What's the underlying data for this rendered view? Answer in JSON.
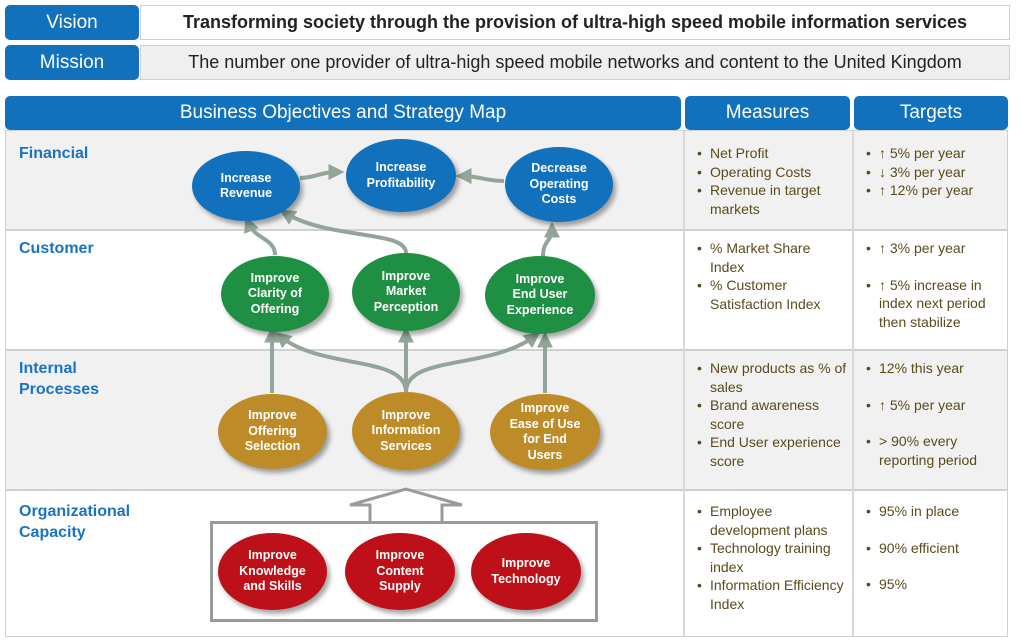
{
  "vision": {
    "label": "Vision",
    "text": "Transforming society through the provision of ultra-high speed mobile information services"
  },
  "mission": {
    "label": "Mission",
    "text": "The number one provider of ultra-high speed mobile networks and content to the United Kingdom"
  },
  "columns": {
    "map": "Business Objectives and Strategy Map",
    "measures": "Measures",
    "targets": "Targets"
  },
  "colors": {
    "header_blue": "#1171bd",
    "financial": "#1171bd",
    "customer": "#1f8f44",
    "internal": "#bd8c29",
    "capacity": "#bd1019",
    "connector": "#92a598",
    "label_blue": "#1a73c2",
    "list_text": "#5a4a1c"
  },
  "rows": [
    {
      "label": "Financial",
      "nodes": [
        "Increase\nRevenue",
        "Increase\nProfitability",
        "Decrease\nOperating\nCosts"
      ],
      "measures": [
        "Net Profit",
        "Operating Costs",
        "Revenue in target markets"
      ],
      "targets": [
        "↑ 5% per year",
        "↓ 3% per year",
        "↑ 12% per year"
      ]
    },
    {
      "label": "Customer",
      "nodes": [
        "Improve\nClarity of\nOffering",
        "Improve\nMarket\nPerception",
        "Improve\nEnd User\nExperience"
      ],
      "measures": [
        "% Market Share Index",
        "% Customer Satisfaction Index"
      ],
      "targets": [
        "↑ 3% per year",
        "↑ 5% increase in index next period then stabilize"
      ]
    },
    {
      "label": "Internal Processes",
      "nodes": [
        "Improve\nOffering\nSelection",
        "Improve\nInformation\nServices",
        "Improve\nEase of Use\nfor End\nUsers"
      ],
      "measures": [
        "New products as % of sales",
        "Brand awareness score",
        "End User experience score"
      ],
      "targets": [
        "12% this year",
        "↑ 5% per year",
        "> 90% every reporting period"
      ]
    },
    {
      "label": "Organizational Capacity",
      "nodes": [
        "Improve\nKnowledge\nand Skills",
        "Improve\nContent\nSupply",
        "Improve\nTechnology"
      ],
      "measures": [
        "Employee development plans",
        "Technology training index",
        "Information Efficiency Index"
      ],
      "targets": [
        "95% in place",
        "90% efficient",
        "95%"
      ]
    }
  ]
}
